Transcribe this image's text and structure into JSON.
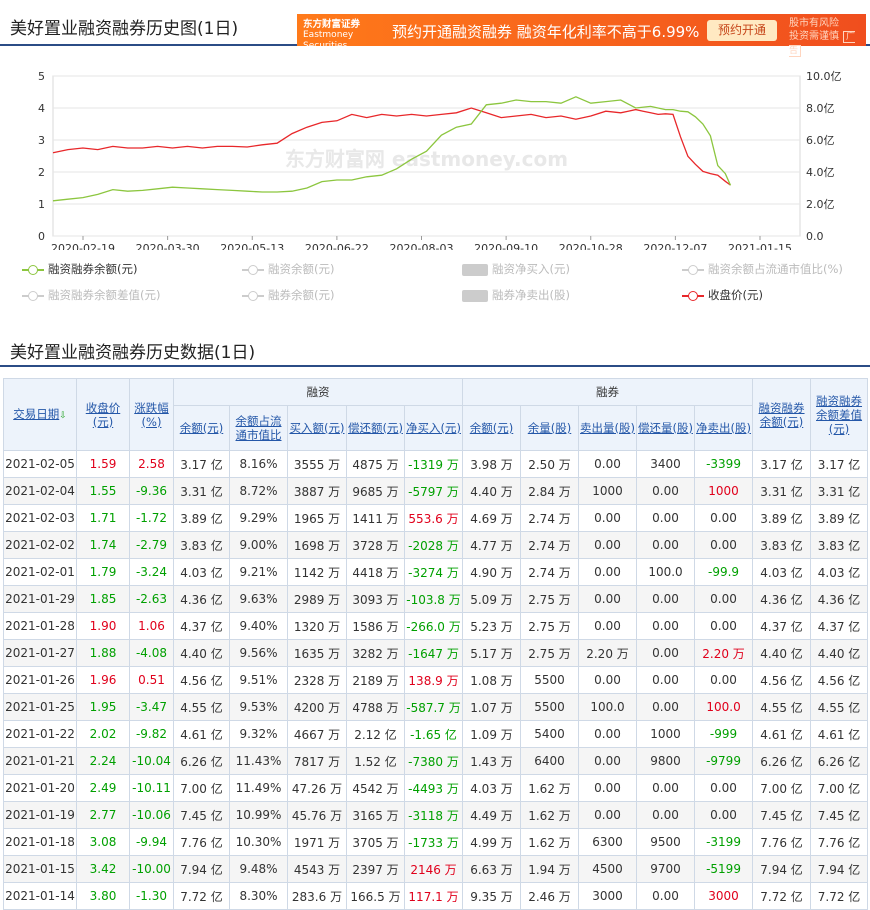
{
  "header": {
    "title": "美好置业融资融券历史图(1日)",
    "ad": {
      "logo_top": "东方财富证券",
      "logo_bottom": "Eastmoney Securities",
      "text": "预约开通融资融券  融资年化利率不高于6.99%",
      "button": "预约开通",
      "note_line1": "股市有风险",
      "note_line2": "投资需谨慎",
      "tag": "广告"
    }
  },
  "legend": {
    "items": [
      {
        "label": "融资融券余额(元)",
        "active": true,
        "color": "#8cc63f",
        "shape": "line"
      },
      {
        "label": "融资余额(元)",
        "active": false,
        "color": "#cccccc",
        "shape": "line"
      },
      {
        "label": "融资净买入(元)",
        "active": false,
        "color": "#cccccc",
        "shape": "box"
      },
      {
        "label": "融资余额占流通市值比(%)",
        "active": false,
        "color": "#cccccc",
        "shape": "line"
      },
      {
        "label": "融资融券余额差值(元)",
        "active": false,
        "color": "#cccccc",
        "shape": "line"
      },
      {
        "label": "融券余额(元)",
        "active": false,
        "color": "#cccccc",
        "shape": "line"
      },
      {
        "label": "融券净卖出(股)",
        "active": false,
        "color": "#cccccc",
        "shape": "box"
      },
      {
        "label": "收盘价(元)",
        "active": true,
        "color": "#e8272a",
        "shape": "line"
      }
    ]
  },
  "chart_data": {
    "type": "line",
    "title": "美好置业融资融券历史图(1日)",
    "watermark": "东方财富网 eastmoney.com",
    "x_ticks": [
      "2020-02-19",
      "2020-03-30",
      "2020-05-13",
      "2020-06-22",
      "2020-08-03",
      "2020-09-10",
      "2020-10-28",
      "2020-12-07",
      "2021-01-15"
    ],
    "y_left": {
      "ticks": [
        "0",
        "1",
        "2",
        "3",
        "4",
        "5"
      ],
      "range": [
        0,
        5
      ]
    },
    "y_right": {
      "ticks": [
        "0.0",
        "2.0亿",
        "4.0亿",
        "6.0亿",
        "8.0亿",
        "10.0亿"
      ],
      "range": [
        0,
        10
      ],
      "unit": "亿"
    },
    "grid": true,
    "series": [
      {
        "name": "收盘价(元)",
        "axis": "left",
        "color": "#e8272a",
        "x": [
          0,
          2,
          4,
          6,
          8,
          10,
          12,
          14,
          16,
          18,
          20,
          22,
          24,
          26,
          28,
          30,
          32,
          34,
          36,
          38,
          40,
          42,
          43,
          44,
          46,
          48,
          50,
          52,
          54,
          56,
          58,
          60,
          62,
          64,
          66,
          68,
          70,
          72,
          74,
          76,
          77,
          78,
          79,
          80,
          81,
          82,
          83,
          84,
          85,
          86,
          87,
          88,
          89,
          90,
          90.7
        ],
        "y": [
          2.6,
          2.7,
          2.75,
          2.7,
          2.8,
          2.75,
          2.75,
          2.8,
          2.75,
          2.8,
          2.75,
          2.8,
          2.8,
          2.78,
          2.85,
          2.9,
          3.2,
          3.4,
          3.55,
          3.6,
          3.8,
          3.7,
          3.75,
          3.8,
          3.75,
          3.8,
          3.75,
          3.8,
          3.85,
          4.0,
          3.85,
          3.7,
          3.75,
          3.8,
          3.7,
          3.75,
          3.65,
          3.75,
          3.9,
          3.85,
          3.9,
          3.95,
          3.9,
          3.85,
          3.8,
          3.82,
          3.8,
          3.1,
          2.49,
          2.24,
          2.02,
          1.95,
          1.9,
          1.71,
          1.59
        ]
      },
      {
        "name": "融资融券余额(元)",
        "axis": "right",
        "color": "#8cc63f",
        "x": [
          0,
          2,
          4,
          6,
          8,
          10,
          12,
          14,
          16,
          18,
          20,
          22,
          24,
          26,
          28,
          30,
          32,
          34,
          36,
          38,
          40,
          42,
          44,
          46,
          48,
          50,
          52,
          54,
          56,
          58,
          60,
          62,
          64,
          66,
          68,
          70,
          72,
          74,
          76,
          78,
          80,
          82,
          83,
          84,
          85,
          86,
          87,
          88,
          89,
          90,
          90.7
        ],
        "y": [
          2.2,
          2.3,
          2.4,
          2.6,
          2.9,
          2.8,
          2.85,
          2.95,
          3.05,
          3.0,
          2.95,
          2.9,
          2.85,
          2.8,
          2.75,
          2.75,
          2.8,
          3.0,
          3.4,
          3.5,
          3.5,
          3.7,
          3.8,
          4.2,
          4.8,
          5.3,
          6.3,
          6.8,
          7.0,
          8.2,
          8.3,
          8.5,
          8.4,
          8.4,
          8.3,
          8.7,
          8.3,
          8.4,
          8.5,
          8.0,
          8.1,
          7.9,
          7.9,
          7.8,
          7.76,
          7.45,
          7.0,
          6.26,
          4.4,
          3.9,
          3.17
        ]
      }
    ]
  },
  "table": {
    "title": "美好置业融资融券历史数据(1日)",
    "group_headers": {
      "rz": "融资",
      "rq": "融券"
    },
    "headers": {
      "date": "交易日期",
      "close": "收盘价(元)",
      "change": "涨跌幅(%)",
      "rz_balance": "余额(元)",
      "rz_ratio": "余额占流通市值比",
      "rz_buy": "买入额(元)",
      "rz_repay": "偿还额(元)",
      "rz_net": "净买入(元)",
      "rq_balance": "余额(元)",
      "rq_volume": "余量(股)",
      "rq_sell": "卖出量(股)",
      "rq_repay": "偿还量(股)",
      "rq_net": "净卖出(股)",
      "total": "融资融券余额(元)",
      "diff": "融资融券余额差值(元)"
    },
    "rows": [
      [
        "2021-02-05",
        "1.59",
        "2.58",
        "3.17 亿",
        "8.16%",
        "3555 万",
        "4875 万",
        "-1319 万",
        "3.98 万",
        "2.50 万",
        "0.00",
        "3400",
        "-3399",
        "3.17 亿",
        "3.17 亿"
      ],
      [
        "2021-02-04",
        "1.55",
        "-9.36",
        "3.31 亿",
        "8.72%",
        "3887 万",
        "9685 万",
        "-5797 万",
        "4.40 万",
        "2.84 万",
        "1000",
        "0.00",
        "1000",
        "3.31 亿",
        "3.31 亿"
      ],
      [
        "2021-02-03",
        "1.71",
        "-1.72",
        "3.89 亿",
        "9.29%",
        "1965 万",
        "1411 万",
        "553.6 万",
        "4.69 万",
        "2.74 万",
        "0.00",
        "0.00",
        "0.00",
        "3.89 亿",
        "3.89 亿"
      ],
      [
        "2021-02-02",
        "1.74",
        "-2.79",
        "3.83 亿",
        "9.00%",
        "1698 万",
        "3728 万",
        "-2028 万",
        "4.77 万",
        "2.74 万",
        "0.00",
        "0.00",
        "0.00",
        "3.83 亿",
        "3.83 亿"
      ],
      [
        "2021-02-01",
        "1.79",
        "-3.24",
        "4.03 亿",
        "9.21%",
        "1142 万",
        "4418 万",
        "-3274 万",
        "4.90 万",
        "2.74 万",
        "0.00",
        "100.0",
        "-99.9",
        "4.03 亿",
        "4.03 亿"
      ],
      [
        "2021-01-29",
        "1.85",
        "-2.63",
        "4.36 亿",
        "9.63%",
        "2989 万",
        "3093 万",
        "-103.8 万",
        "5.09 万",
        "2.75 万",
        "0.00",
        "0.00",
        "0.00",
        "4.36 亿",
        "4.36 亿"
      ],
      [
        "2021-01-28",
        "1.90",
        "1.06",
        "4.37 亿",
        "9.40%",
        "1320 万",
        "1586 万",
        "-266.0 万",
        "5.23 万",
        "2.75 万",
        "0.00",
        "0.00",
        "0.00",
        "4.37 亿",
        "4.37 亿"
      ],
      [
        "2021-01-27",
        "1.88",
        "-4.08",
        "4.40 亿",
        "9.56%",
        "1635 万",
        "3282 万",
        "-1647 万",
        "5.17 万",
        "2.75 万",
        "2.20 万",
        "0.00",
        "2.20 万",
        "4.40 亿",
        "4.40 亿"
      ],
      [
        "2021-01-26",
        "1.96",
        "0.51",
        "4.56 亿",
        "9.51%",
        "2328 万",
        "2189 万",
        "138.9 万",
        "1.08 万",
        "5500",
        "0.00",
        "0.00",
        "0.00",
        "4.56 亿",
        "4.56 亿"
      ],
      [
        "2021-01-25",
        "1.95",
        "-3.47",
        "4.55 亿",
        "9.53%",
        "4200 万",
        "4788 万",
        "-587.7 万",
        "1.07 万",
        "5500",
        "100.0",
        "0.00",
        "100.0",
        "4.55 亿",
        "4.55 亿"
      ],
      [
        "2021-01-22",
        "2.02",
        "-9.82",
        "4.61 亿",
        "9.32%",
        "4667 万",
        "2.12 亿",
        "-1.65 亿",
        "1.09 万",
        "5400",
        "0.00",
        "1000",
        "-999",
        "4.61 亿",
        "4.61 亿"
      ],
      [
        "2021-01-21",
        "2.24",
        "-10.04",
        "6.26 亿",
        "11.43%",
        "7817 万",
        "1.52 亿",
        "-7380 万",
        "1.43 万",
        "6400",
        "0.00",
        "9800",
        "-9799",
        "6.26 亿",
        "6.26 亿"
      ],
      [
        "2021-01-20",
        "2.49",
        "-10.11",
        "7.00 亿",
        "11.49%",
        "47.26 万",
        "4542 万",
        "-4493 万",
        "4.03 万",
        "1.62 万",
        "0.00",
        "0.00",
        "0.00",
        "7.00 亿",
        "7.00 亿"
      ],
      [
        "2021-01-19",
        "2.77",
        "-10.06",
        "7.45 亿",
        "10.99%",
        "45.76 万",
        "3165 万",
        "-3118 万",
        "4.49 万",
        "1.62 万",
        "0.00",
        "0.00",
        "0.00",
        "7.45 亿",
        "7.45 亿"
      ],
      [
        "2021-01-18",
        "3.08",
        "-9.94",
        "7.76 亿",
        "10.30%",
        "1971 万",
        "3705 万",
        "-1733 万",
        "4.99 万",
        "1.62 万",
        "6300",
        "9500",
        "-3199",
        "7.76 亿",
        "7.76 亿"
      ],
      [
        "2021-01-15",
        "3.42",
        "-10.00",
        "7.94 亿",
        "9.48%",
        "4543 万",
        "2397 万",
        "2146 万",
        "6.63 万",
        "1.94 万",
        "4500",
        "9700",
        "-5199",
        "7.94 亿",
        "7.94 亿"
      ],
      [
        "2021-01-14",
        "3.80",
        "-1.30",
        "7.72 亿",
        "8.30%",
        "283.6 万",
        "166.5 万",
        "117.1 万",
        "9.35 万",
        "2.46 万",
        "3000",
        "0.00",
        "3000",
        "7.72 亿",
        "7.72 亿"
      ]
    ]
  }
}
